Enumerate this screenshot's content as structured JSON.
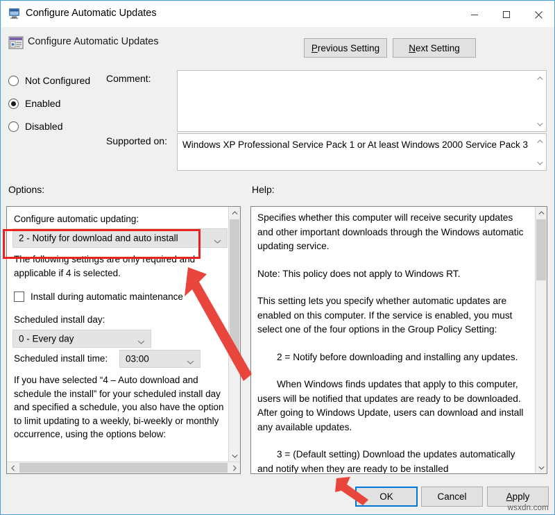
{
  "window": {
    "title": "Configure Automatic Updates",
    "title_icon": "monitor-icon",
    "minimize_label": "—",
    "maximize_label": "□",
    "close_label": "✕"
  },
  "header": {
    "setting_name": "Configure Automatic Updates",
    "icon": "policy-setting-icon",
    "previous_setting_label": "Previous Setting",
    "previous_setting_mnemonic": "P",
    "next_setting_label": "Next Setting",
    "next_setting_mnemonic": "N"
  },
  "state_radios": [
    {
      "label": "Not Configured",
      "mnemonic": "C",
      "selected": false
    },
    {
      "label": "Enabled",
      "mnemonic": "E",
      "selected": true
    },
    {
      "label": "Disabled",
      "mnemonic": "D",
      "selected": false
    }
  ],
  "comment": {
    "label": "Comment:",
    "value": "",
    "placeholder": ""
  },
  "supported_on": {
    "label": "Supported on:",
    "value": "Windows XP Professional Service Pack 1 or At least Windows 2000 Service Pack 3"
  },
  "options": {
    "label": "Options:",
    "configure_updating_label": "Configure automatic updating:",
    "configure_updating_value": "2 - Notify for download and auto install",
    "description_1": "The following settings are only required and applicable if 4 is selected.",
    "maintenance_checkbox_label": "Install during automatic maintenance",
    "maintenance_checked": false,
    "install_day_label": "Scheduled install day:",
    "install_day_value": "0 - Every day",
    "install_time_label": "Scheduled install time:",
    "install_time_value": "03:00",
    "description_2": "If you have selected “4 – Auto download and schedule the install” for your scheduled install day and specified a schedule, you also have the option to limit updating to a weekly, bi-weekly or monthly occurrence, using the options below:"
  },
  "help": {
    "label": "Help:",
    "paragraphs": [
      {
        "text": "Specifies whether this computer will receive security updates and other important downloads through the Windows automatic updating service.",
        "indent": false
      },
      {
        "text": "Note: This policy does not apply to Windows RT.",
        "indent": false
      },
      {
        "text": "This setting lets you specify whether automatic updates are enabled on this computer. If the service is enabled, you must select one of the four options in the Group Policy Setting:",
        "indent": false
      },
      {
        "text": "2 = Notify before downloading and installing any updates.",
        "indent": true
      },
      {
        "text": "When Windows finds updates that apply to this computer, users will be notified that updates are ready to be downloaded. After going to Windows Update, users can download and install any available updates.",
        "indent": true
      },
      {
        "text": "3 = (Default setting) Download the updates automatically and notify when they are ready to be installed",
        "indent": true
      }
    ]
  },
  "footer": {
    "ok_label": "OK",
    "cancel_label": "Cancel",
    "apply_label": "Apply",
    "apply_mnemonic": "A"
  },
  "annotations": {
    "highlight_color": "#e8231f",
    "focus_color": "#0078d7",
    "watermark": "wsxdn.com"
  }
}
